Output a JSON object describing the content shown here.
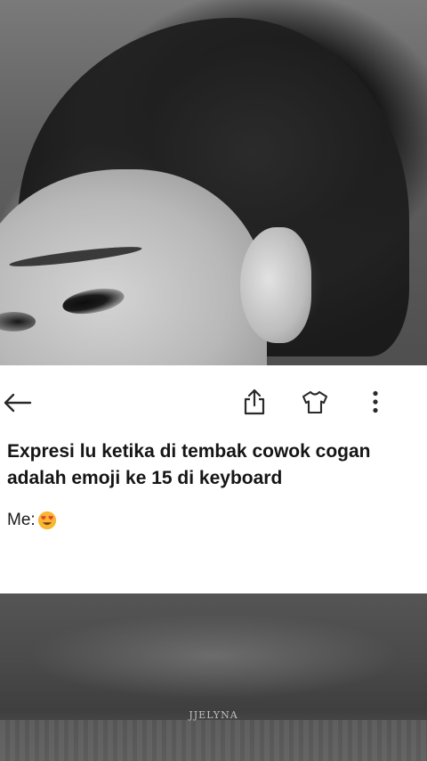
{
  "post": {
    "title": "Expresi lu ketika di tembak cowok cogan adalah emoji ke 15 di keyboard",
    "body_prefix": "Me:",
    "body_emoji_icon": "smiling-face-with-heart-eyes-icon"
  },
  "toolbar": {
    "back_icon": "arrow-left-icon",
    "share_icon": "share-icon",
    "shirt_icon": "tshirt-icon",
    "more_icon": "more-vertical-icon"
  },
  "overlay": {
    "watermark": "JJELYNA"
  },
  "colors": {
    "card_background": "#ffffff",
    "text": "#151515",
    "icon": "#2a2a2a",
    "emoji_face": "#f7b731",
    "emoji_heart": "#e8413c"
  }
}
